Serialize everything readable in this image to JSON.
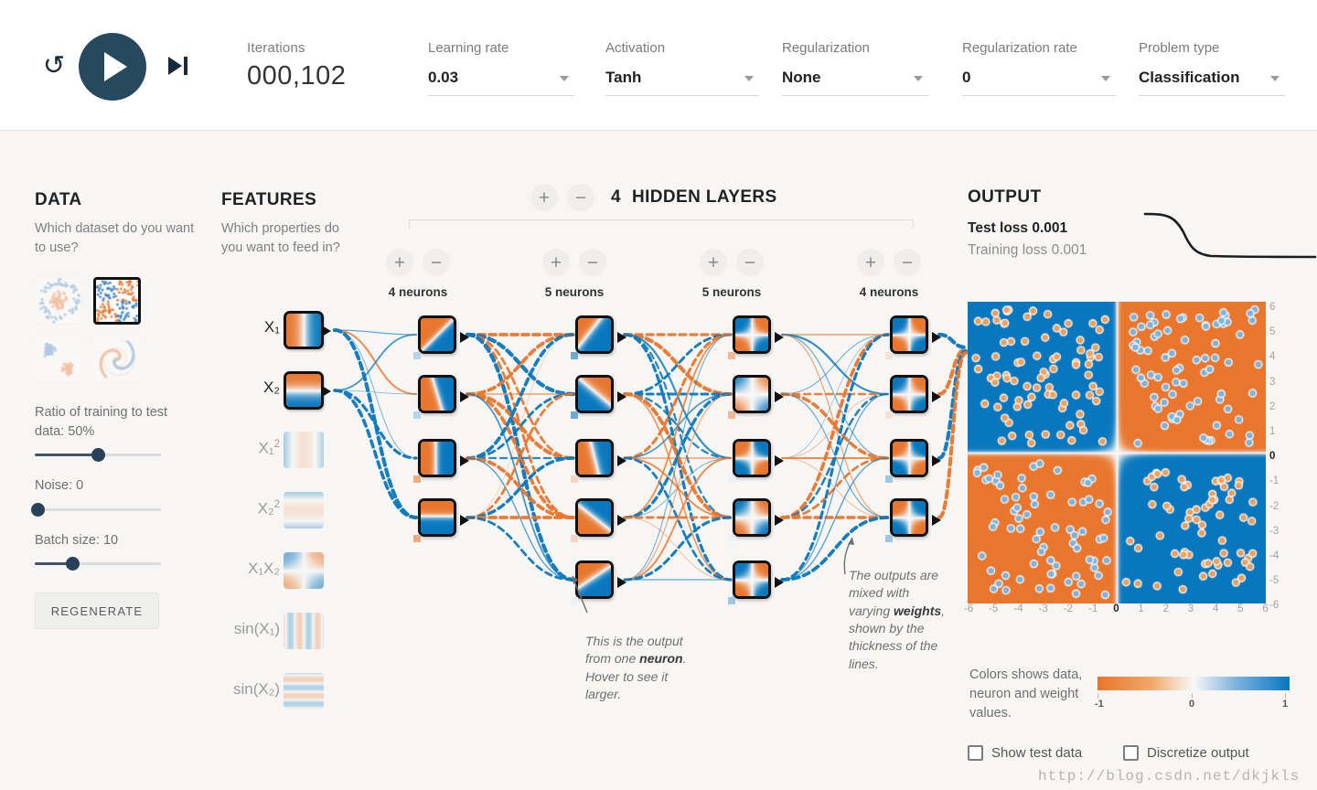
{
  "header": {
    "reset_icon": "reset-icon",
    "play_icon": "play-icon",
    "step_icon": "step-forward-icon",
    "iterations_label": "Iterations",
    "iterations_value": "000,102",
    "controls": [
      {
        "label": "Learning rate",
        "value": "0.03"
      },
      {
        "label": "Activation",
        "value": "Tanh"
      },
      {
        "label": "Regularization",
        "value": "None"
      },
      {
        "label": "Regularization rate",
        "value": "0"
      },
      {
        "label": "Problem type",
        "value": "Classification"
      }
    ]
  },
  "data_panel": {
    "title": "DATA",
    "question": "Which dataset do you want to use?",
    "datasets": [
      {
        "name": "circle",
        "selected": false
      },
      {
        "name": "xor",
        "selected": true
      },
      {
        "name": "gauss",
        "selected": false
      },
      {
        "name": "spiral",
        "selected": false
      }
    ],
    "ratio_label": "Ratio of training to test data:  50%",
    "ratio_percent": 50,
    "noise_label": "Noise:  0",
    "noise_percent": 0,
    "batch_label": "Batch size:  10",
    "batch_percent": 30,
    "regenerate_label": "REGENERATE"
  },
  "features_panel": {
    "title": "FEATURES",
    "question": "Which properties do you want to feed in?",
    "features": [
      {
        "id": "x1",
        "label": "X₁",
        "active": true
      },
      {
        "id": "x2",
        "label": "X₂",
        "active": true
      },
      {
        "id": "x1sq",
        "label": "X₁²",
        "active": false
      },
      {
        "id": "x2sq",
        "label": "X₂²",
        "active": false
      },
      {
        "id": "x1x2",
        "label": "X₁X₂",
        "active": false
      },
      {
        "id": "sinx1",
        "label": "sin(X₁)",
        "active": false
      },
      {
        "id": "sinx2",
        "label": "sin(X₂)",
        "active": false
      }
    ]
  },
  "network_panel": {
    "add_layer_label": "+",
    "remove_layer_label": "−",
    "hidden_layers_count": "4",
    "hidden_layers_label": "HIDDEN LAYERS",
    "layers": [
      {
        "neurons": 4,
        "count_label": "4 neurons"
      },
      {
        "neurons": 5,
        "count_label": "5 neurons"
      },
      {
        "neurons": 5,
        "count_label": "5 neurons"
      },
      {
        "neurons": 4,
        "count_label": "4 neurons"
      }
    ],
    "annotation_neuron": "This is the output from one neuron. Hover to see it larger.",
    "annotation_neuron_parts": {
      "a": "This is the output from one ",
      "b": "neuron",
      "c": ". Hover to see it larger."
    },
    "annotation_weights_parts": {
      "a": "The outputs are mixed with varying ",
      "b": "weights",
      "c": ", shown by the thickness of the lines."
    }
  },
  "output_panel": {
    "title": "OUTPUT",
    "test_loss": "Test loss 0.001",
    "training_loss": "Training loss 0.001",
    "y_ticks": [
      "6",
      "5",
      "4",
      "3",
      "2",
      "1",
      "0",
      "-1",
      "-2",
      "-3",
      "-4",
      "-5",
      "-6"
    ],
    "x_ticks": [
      "-6",
      "-5",
      "-4",
      "-3",
      "-2",
      "-1",
      "0",
      "1",
      "2",
      "3",
      "4",
      "5",
      "6"
    ],
    "legend_text": "Colors shows data, neuron and weight values.",
    "legend_ticks": [
      "-1",
      "0",
      "1"
    ],
    "show_test_data_label": "Show test data",
    "discretize_output_label": "Discretize output",
    "show_test_data_checked": false,
    "discretize_output_checked": false
  },
  "colors": {
    "orange": "#e8762d",
    "blue": "#0877bd",
    "dark": "#27495f",
    "background": "#f7f6f4"
  },
  "watermark": "http://blog.csdn.net/dkjkls",
  "chart_data": {
    "type": "heatmap",
    "title": "OUTPUT",
    "xlabel": "",
    "ylabel": "",
    "xlim": [
      -6,
      6
    ],
    "ylim": [
      -6,
      6
    ],
    "grid": false,
    "description": "XOR classification decision boundary: orange in top-left and bottom-right quadrants, blue in top-right and bottom-left quadrants",
    "quadrants": [
      {
        "x_range": [
          -6,
          0
        ],
        "y_range": [
          0,
          6
        ],
        "class": "orange",
        "value": 1
      },
      {
        "x_range": [
          0,
          6
        ],
        "y_range": [
          0,
          6
        ],
        "class": "blue",
        "value": -1
      },
      {
        "x_range": [
          -6,
          0
        ],
        "y_range": [
          -6,
          0
        ],
        "class": "blue",
        "value": -1
      },
      {
        "x_range": [
          0,
          6
        ],
        "y_range": [
          -6,
          0
        ],
        "class": "orange",
        "value": 1
      }
    ],
    "colorbar": {
      "min": -1,
      "mid": 0,
      "max": 1,
      "min_color": "#e8762d",
      "max_color": "#0877bd"
    },
    "loss_curve": {
      "type": "line",
      "description": "training loss decreasing sigmoid curve",
      "ylim": [
        0,
        1
      ]
    }
  }
}
